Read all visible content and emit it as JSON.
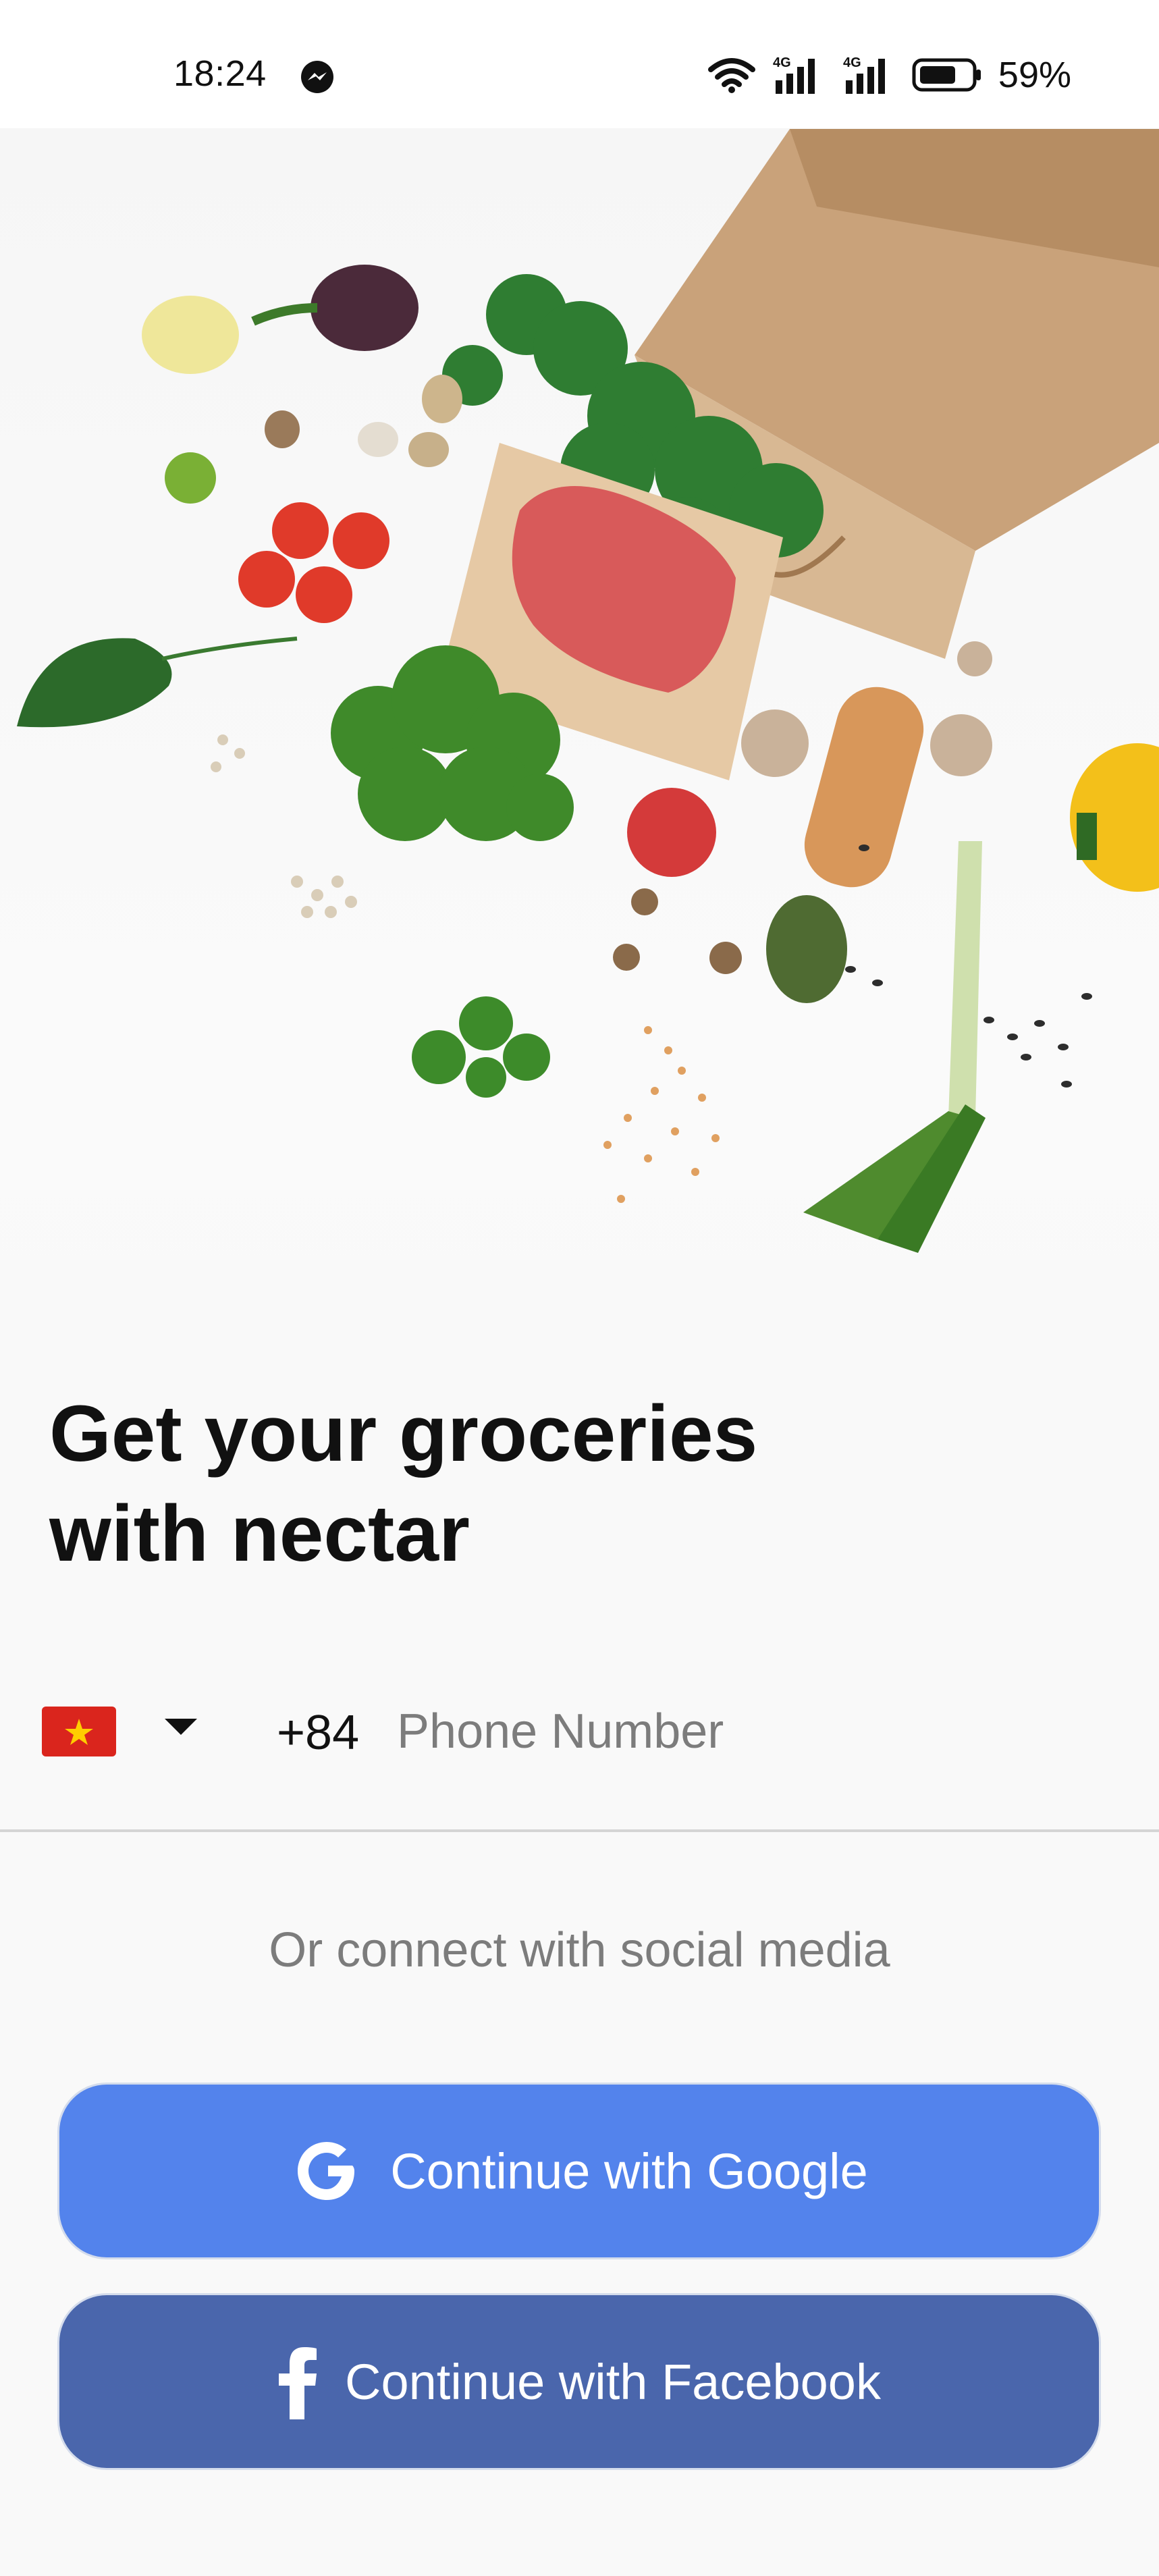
{
  "status_bar": {
    "time": "18:24",
    "battery": "59%",
    "icons": [
      "messenger-icon",
      "wifi-icon",
      "signal-4g-icon",
      "signal-4g-icon",
      "battery-icon"
    ]
  },
  "hero": {
    "image": "groceries-illustration"
  },
  "headline": {
    "line1": "Get your groceries",
    "line2": "with nectar"
  },
  "phone": {
    "country_flag": "vietnam-flag-icon",
    "dial_code": "+84",
    "placeholder": "Phone Number",
    "value": ""
  },
  "social": {
    "caption": "Or connect with social media",
    "google_label": "Continue with Google",
    "facebook_label": "Continue with Facebook"
  },
  "colors": {
    "google_button": "#5383ec",
    "facebook_button": "#4a66ac",
    "background": "#f9f9f9"
  }
}
